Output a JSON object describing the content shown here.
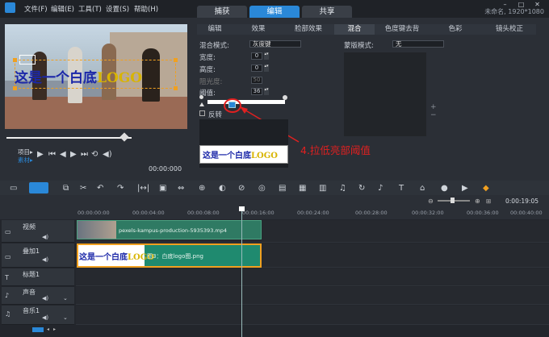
{
  "menu": {
    "file": "文件(F)",
    "edit": "编辑(E)",
    "tools": "工具(T)",
    "settings": "设置(S)",
    "help": "帮助(H)"
  },
  "title_info": "未命名, 1920*1080",
  "tabs": [
    {
      "label": "捕获"
    },
    {
      "label": "编辑"
    },
    {
      "label": "共享"
    }
  ],
  "preview": {
    "overlay_main": "这是一个白底",
    "overlay_logo": "LOGO",
    "time": "00:00:00",
    "frame": "0",
    "mode_labels": [
      "项目▸",
      "素材▸"
    ]
  },
  "panel_tabs_top": [
    "编辑",
    "效果",
    "脸部效果",
    "混合",
    "色度键去背",
    "色彩",
    "镜头校正"
  ],
  "blend": {
    "mode_label": "混合模式:",
    "mode_value": "灰度键",
    "width_label": "宽度:",
    "width_value": "0",
    "height_label": "高度:",
    "height_value": "0",
    "opacity_label": "阻光度:",
    "opacity_value": "50",
    "threshold_label": "阈值:",
    "threshold_value": "36",
    "flip_label": "反转",
    "mask_mode_label": "蒙版模式:",
    "mask_mode_value": "无"
  },
  "annotation": "4.拉低亮部阈值",
  "thumb": {
    "main": "这是一个白底",
    "logo": "LOGO"
  },
  "timeline": {
    "ticks": [
      "00:00:00:00",
      "00:00:04:00",
      "00:00:08:00",
      "00:00:12:00",
      "00:00:16:00",
      "00:00:20:00",
      "00:00:24:00",
      "00:00:28:00",
      "00:00:32:00",
      "00:00:36:00",
      "00:00:40:00"
    ],
    "zoom_time": "0:00:19:05",
    "tracks": [
      {
        "name": "视频"
      },
      {
        "name": "叠加1"
      },
      {
        "name": "标题1"
      },
      {
        "name": "声音"
      },
      {
        "name": "音乐1"
      }
    ],
    "clip_video": "pexels-kampus-production-5935393.mp4",
    "clip_overlay": "图3：白底logo图.png"
  },
  "colors": {
    "accent": "#2a88d8",
    "annotation": "#e02020",
    "selection": "#f0a020"
  }
}
